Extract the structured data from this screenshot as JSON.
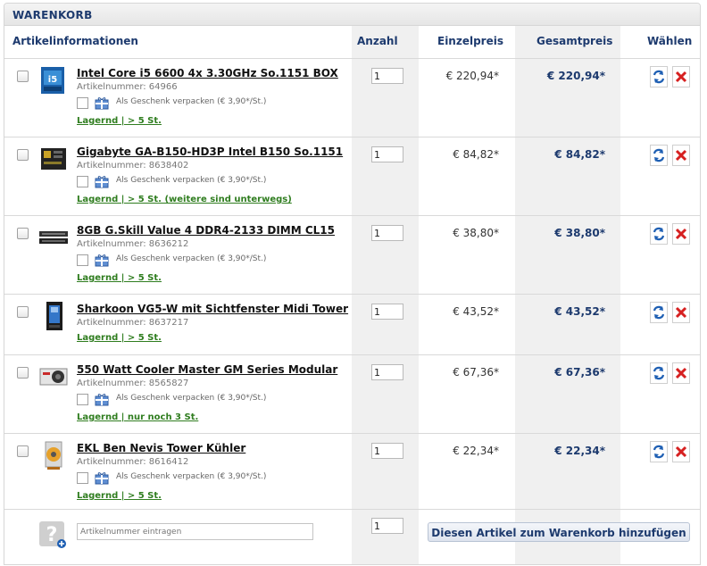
{
  "cart": {
    "title": "WARENKORB",
    "headers": {
      "info": "Artikelinformationen",
      "qty": "Anzahl",
      "unit_price": "Einzelpreis",
      "total_price": "Gesamtpreis",
      "select": "Wählen"
    },
    "gift_label": "Als Geschenk verpacken (€ 3,90*/St.)",
    "items": [
      {
        "name": "Intel Core i5 6600 4x 3.30GHz So.1151 BOX",
        "artnr": "Artikelnummer: 64966",
        "gift": true,
        "stock": "Lagernd | > 5 St.",
        "qty": "1",
        "unit": "€ 220,94*",
        "total": "€ 220,94*",
        "thumb": "cpu-icon"
      },
      {
        "name": "Gigabyte GA-B150-HD3P Intel B150 So.1151",
        "artnr": "Artikelnummer: 8638402",
        "gift": true,
        "stock": "Lagernd | > 5 St. (weitere sind unterwegs)",
        "qty": "1",
        "unit": "€ 84,82*",
        "total": "€ 84,82*",
        "thumb": "motherboard-icon"
      },
      {
        "name": "8GB G.Skill Value 4 DDR4-2133 DIMM CL15",
        "artnr": "Artikelnummer: 8636212",
        "gift": true,
        "stock": "Lagernd | > 5 St.",
        "qty": "1",
        "unit": "€ 38,80*",
        "total": "€ 38,80*",
        "thumb": "ram-icon"
      },
      {
        "name": "Sharkoon VG5-W mit Sichtfenster Midi Tower",
        "artnr": "Artikelnummer: 8637217",
        "gift": false,
        "stock": "Lagernd | > 5 St.",
        "qty": "1",
        "unit": "€ 43,52*",
        "total": "€ 43,52*",
        "thumb": "case-icon"
      },
      {
        "name": "550 Watt Cooler Master GM Series Modular",
        "artnr": "Artikelnummer: 8565827",
        "gift": true,
        "stock": "Lagernd | nur noch 3 St.",
        "qty": "1",
        "unit": "€ 67,36*",
        "total": "€ 67,36*",
        "thumb": "psu-icon"
      },
      {
        "name": "EKL Ben Nevis Tower Kühler",
        "artnr": "Artikelnummer: 8616412",
        "gift": true,
        "stock": "Lagernd | > 5 St.",
        "qty": "1",
        "unit": "€ 22,34*",
        "total": "€ 22,34*",
        "thumb": "cooler-icon"
      }
    ],
    "add": {
      "placeholder": "Artikelnummer eintragen",
      "qty": "1",
      "button_label": "Diesen Artikel zum Warenkorb hinzufügen"
    }
  },
  "colors": {
    "accent": "#1d3a6e",
    "stock": "#2f7d1f",
    "delete": "#d62020",
    "refresh": "#1e5fb3"
  }
}
